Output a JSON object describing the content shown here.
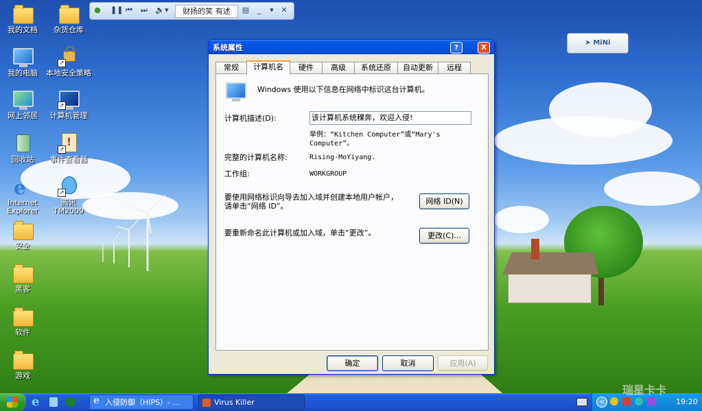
{
  "desktop": {
    "icons": [
      {
        "label": "我的文档"
      },
      {
        "label": "我的电脑"
      },
      {
        "label": "网上邻居"
      },
      {
        "label": "回收站"
      },
      {
        "label": "Internet Explorer"
      },
      {
        "label": "安全"
      },
      {
        "label": "黑客"
      },
      {
        "label": "软件"
      },
      {
        "label": "游戏"
      },
      {
        "label": "杂货仓库"
      },
      {
        "label": "本地安全策略"
      },
      {
        "label": "计算机管理"
      },
      {
        "label": "事件查看器"
      },
      {
        "label": "腾讯TM2009"
      }
    ]
  },
  "player": {
    "song": "财扬的笑 有述"
  },
  "mini_widget": {
    "label": "MiNi"
  },
  "dialog": {
    "title": "系统属性",
    "help_btn": "?",
    "close_btn": "X",
    "tabs": [
      {
        "label": "常规"
      },
      {
        "label": "计算机名",
        "active": true
      },
      {
        "label": "硬件"
      },
      {
        "label": "高级"
      },
      {
        "label": "系统还原"
      },
      {
        "label": "自动更新"
      },
      {
        "label": "远程"
      }
    ],
    "intro": "Windows 使用以下信息在网络中标识这台计算机。",
    "desc_label": "计算机描述(D):",
    "desc_value": "该计算机系统稞奔，欢迎入侵!",
    "example": "举例：“Kitchen Computer”或“Mary's Computer”。",
    "fullname_label": "完整的计算机名称:",
    "fullname_value": "Rising-MoYiyang.",
    "workgroup_label": "工作组:",
    "workgroup_value": "WORKGROUP",
    "network_text": "要使用网络标识向导去加入域并创建本地用户帐户，请单击“网络 ID”。",
    "network_btn": "网络 ID(N)",
    "rename_text": "要重新命名此计算机或加入域，单击“更改”。",
    "change_btn": "更改(C)...",
    "ok_btn": "确定",
    "cancel_btn": "取消",
    "apply_btn": "应用(A)"
  },
  "taskbar": {
    "items": [
      {
        "label": "入侵防御（HIPS）- ..."
      },
      {
        "label": "Virus Killer"
      }
    ],
    "clock": "19:20",
    "watermark": "瑞星卡卡"
  }
}
